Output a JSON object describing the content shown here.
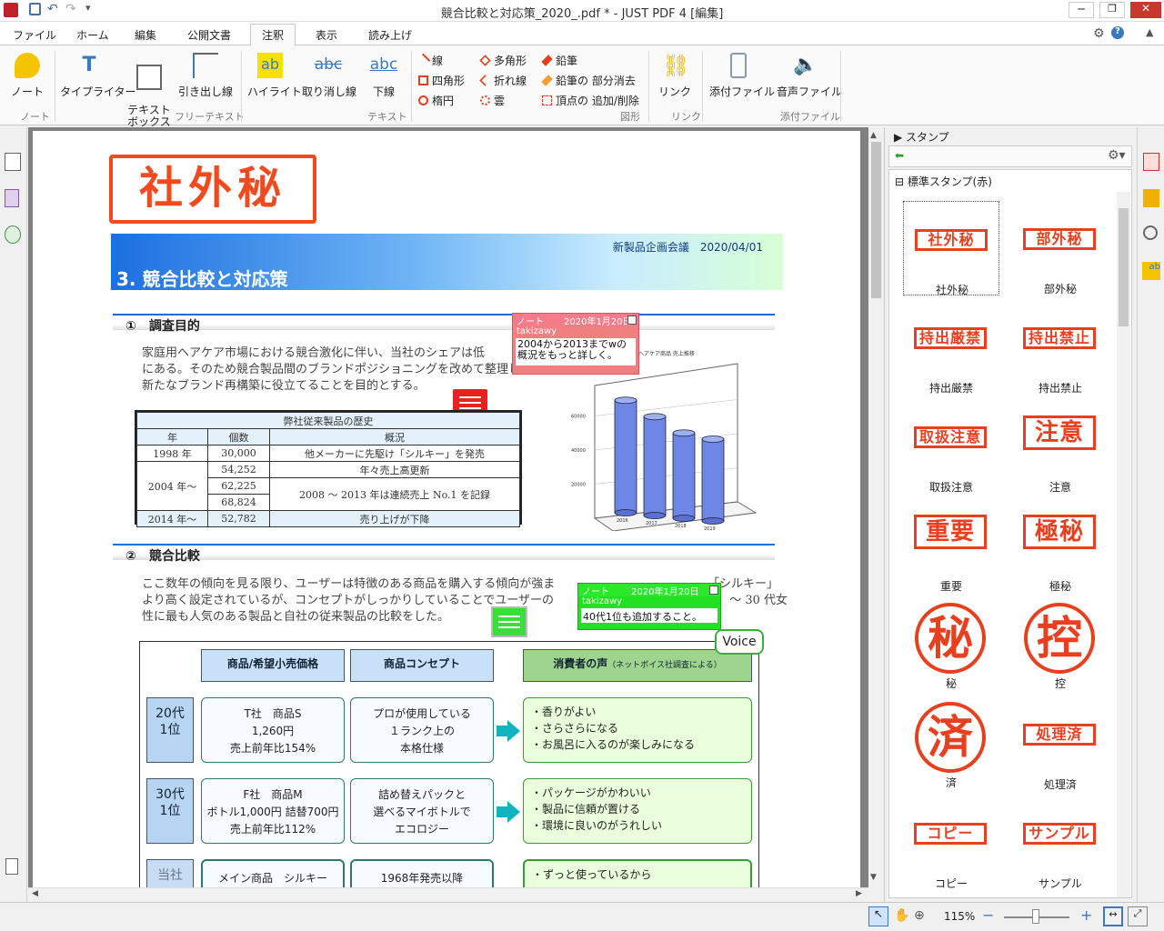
{
  "window": {
    "title": "競合比較と対応策_2020_.pdf * - JUST PDF 4 [編集]"
  },
  "menu": [
    "ファイル",
    "ホーム",
    "編集",
    "公開文書",
    "注釈",
    "表示",
    "読み上げ"
  ],
  "menu_active": "注釈",
  "ribbon": {
    "note": "ノート",
    "group_note": "ノート",
    "typewriter": "タイプライター",
    "textbox": "テキスト\nボックス",
    "callout": "引き出し線",
    "group_freetext": "フリーテキスト",
    "highlight": "ハイライト",
    "strike": "取り消し線",
    "underline": "下線",
    "group_text": "テキスト",
    "shape_line": "線",
    "shape_rect": "四角形",
    "shape_ellipse": "楕円",
    "shape_polygon": "多角形",
    "shape_polyline": "折れ線",
    "shape_cloud": "雲",
    "pencil": "鉛筆",
    "pencil_erase": "鉛筆の 部分消去",
    "vertex": "頂点の 追加/削除",
    "group_shape": "図形",
    "link": "リンク",
    "group_link": "リンク",
    "attach_file": "添付ファイル",
    "sound_file": "音声ファイル",
    "group_attach": "添付ファイル"
  },
  "document": {
    "stamp": "社外秘",
    "meeting": "新製品企画会議　2020/04/01",
    "heading": "3. 競合比較と対応策",
    "section1": "①　調査目的",
    "para1": [
      "家庭用ヘアケア市場における競合激化に伴い、当社のシェアは低",
      "にある。そのため競合製品間のブランドポジショニングを改めて整理し、",
      "新たなブランド再構築に役立てることを目的とする。"
    ],
    "table": {
      "title": "弊社従来製品の歴史",
      "headers": [
        "年",
        "個数",
        "概況"
      ],
      "rows": [
        [
          "1998 年",
          "30,000",
          "他メーカーに先駆け「シルキー」を発売"
        ],
        [
          "2004 年～",
          "54,252",
          "年々売上高更新"
        ],
        [
          "",
          "62,225",
          "2008 ～ 2013 年は連続売上 No.1 を記録"
        ],
        [
          "",
          "68,824",
          ""
        ],
        [
          "2014 年～",
          "52,782",
          "売り上げが下降"
        ]
      ]
    },
    "chart_caption": "社ヘアケア商品 売上推移",
    "section2": "②　競合比較",
    "para2": [
      "ここ数年の傾向を見る限り、ユーザーは特徴のある商品を購入する傾向が強ま",
      "「シルキー」",
      "より高く設定されているが、コンセプトがしっかりしていることでユーザーの",
      "～ 30 代女",
      "性に最も人気のある製品と自社の従来製品の比較をした。"
    ],
    "compare": {
      "h1": "商品/希望小売価格",
      "h2": "商品コンセプト",
      "h3": "消費者の声",
      "h3_sub": "（ネットボイス社調査による）",
      "rows": [
        {
          "age": "20代\n1位",
          "product": "T社　商品S\n1,260円\n売上前年比154%",
          "concept": "プロが使用している\n１ランク上の\n本格仕様",
          "voice": "・香りがよい\n・さらさらになる\n・お風呂に入るのが楽しみになる"
        },
        {
          "age": "30代\n1位",
          "product": "F社　商品M\nボトル1,000円 詰替700円\n売上前年比112%",
          "concept": "詰め替えパックと\n選べるマイボトルで\nエコロジー",
          "voice": "・パッケージがかわいい\n・製品に信頼が置ける\n・環境に良いのがうれしい"
        },
        {
          "age": "当社",
          "product": "メイン商品　シルキー",
          "concept": "1968年発売以降",
          "voice": "・ずっと使っているから"
        }
      ]
    }
  },
  "notes": [
    {
      "type": "ノート",
      "date": "2020年1月20日",
      "author": "takizawy",
      "text": "2004から2013までwの概況をもっと詳しく。"
    },
    {
      "type": "ノート",
      "date": "2020年1月20日",
      "author": "takizawy",
      "text": "40代1位も追加すること。"
    }
  ],
  "voice_label": "Voice",
  "chart_data": {
    "type": "bar",
    "categories": [
      "2016",
      "2017",
      "2018",
      "2019"
    ],
    "values": [
      66000,
      58000,
      50000,
      48000
    ],
    "ylim": [
      0,
      80000
    ],
    "yticks": [
      "20000",
      "40000",
      "60000"
    ],
    "title": "社ヘアケア商品 売上推移"
  },
  "panel": {
    "section": "スタンプ",
    "category": "標準スタンプ(赤)",
    "stamps": [
      {
        "text": "社外秘",
        "label": "社外秘",
        "kind": "rect"
      },
      {
        "text": "部外秘",
        "label": "部外秘",
        "kind": "rect"
      },
      {
        "text": "持出厳禁",
        "label": "持出厳禁",
        "kind": "rect"
      },
      {
        "text": "持出禁止",
        "label": "持出禁止",
        "kind": "rect"
      },
      {
        "text": "取扱注意",
        "label": "取扱注意",
        "kind": "rect"
      },
      {
        "text": "注意",
        "label": "注意",
        "kind": "rect"
      },
      {
        "text": "重要",
        "label": "重要",
        "kind": "rect"
      },
      {
        "text": "極秘",
        "label": "極秘",
        "kind": "rect"
      },
      {
        "text": "秘",
        "label": "秘",
        "kind": "circle"
      },
      {
        "text": "控",
        "label": "控",
        "kind": "circle"
      },
      {
        "text": "済",
        "label": "済",
        "kind": "circle"
      },
      {
        "text": "処理済",
        "label": "処理済",
        "kind": "rect"
      },
      {
        "text": "コピー",
        "label": "コピー",
        "kind": "rect"
      },
      {
        "text": "サンプル",
        "label": "サンプル",
        "kind": "rect"
      }
    ]
  },
  "status": {
    "zoom": "115%"
  }
}
